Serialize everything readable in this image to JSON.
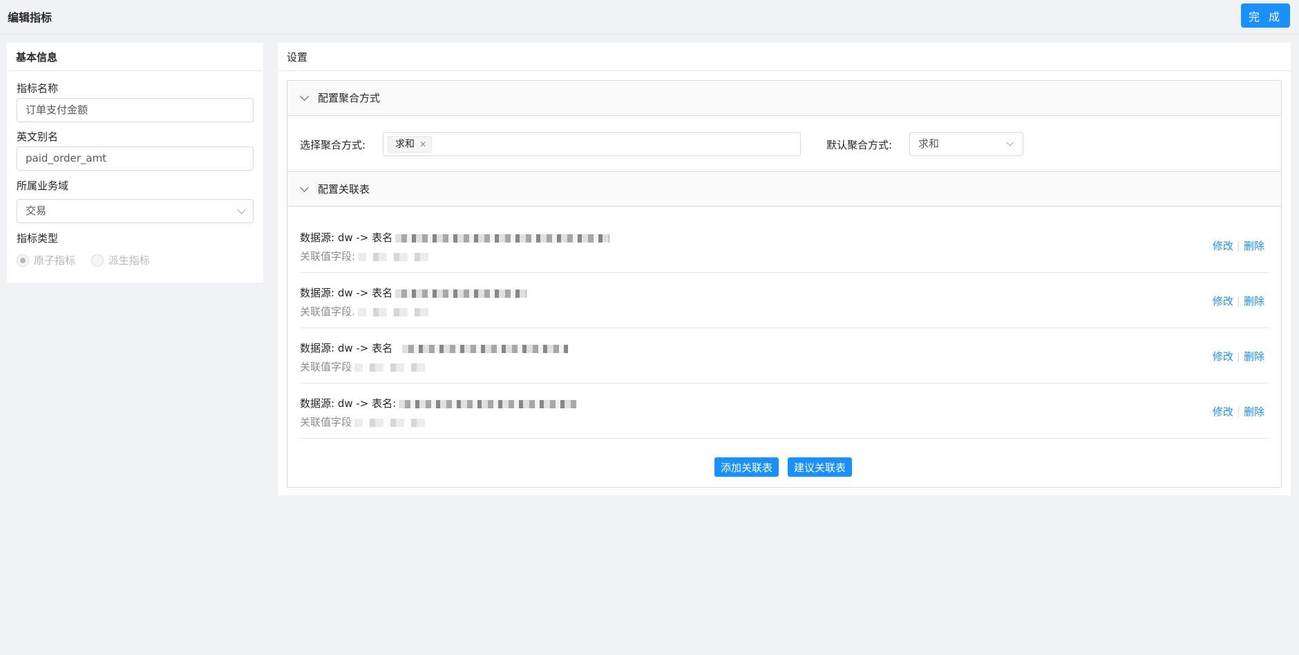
{
  "header": {
    "title": "编辑指标",
    "done_label": "完 成"
  },
  "basic_info": {
    "title": "基本信息",
    "name_label": "指标名称",
    "name_value": "订单支付金额",
    "alias_label": "英文别名",
    "alias_value": "paid_order_amt",
    "domain_label": "所属业务域",
    "domain_value": "交易",
    "type_label": "指标类型",
    "type_options": [
      "原子指标",
      "派生指标"
    ]
  },
  "settings": {
    "title": "设置",
    "agg_section_title": "配置聚合方式",
    "select_agg_label": "选择聚合方式:",
    "selected_agg_tag": "求和",
    "default_agg_label": "默认聚合方式:",
    "default_agg_value": "求和",
    "rel_section_title": "配置关联表",
    "relations": [
      {
        "source": "数据源: dw -> 表名",
        "field": "关联值字段:",
        "edit": "修改",
        "delete": "删除"
      },
      {
        "source": "数据源: dw -> 表名",
        "field": "关联值字段.",
        "edit": "修改",
        "delete": "删除"
      },
      {
        "source": "数据源: dw -> 表名",
        "field": "关联值字段",
        "edit": "修改",
        "delete": "删除"
      },
      {
        "source": "数据源: dw -> 表名:",
        "field": "关联值字段",
        "edit": "修改",
        "delete": "删除"
      }
    ],
    "add_relation_label": "添加关联表",
    "suggest_relation_label": "建议关联表"
  }
}
